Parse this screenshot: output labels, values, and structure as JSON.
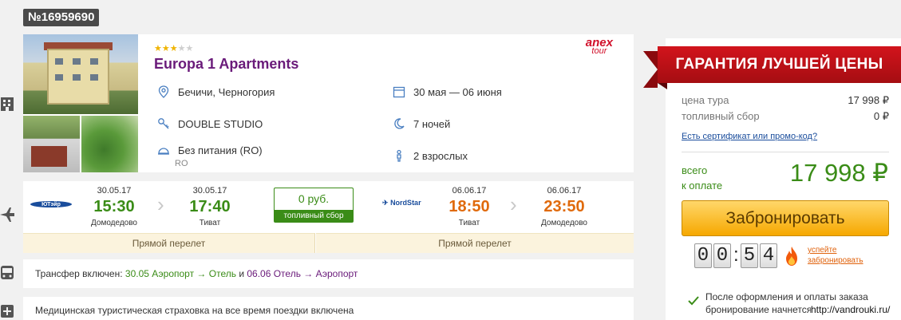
{
  "order": {
    "id": "№16959690"
  },
  "hotel": {
    "stars_filled": 3,
    "stars_total": 5,
    "name": "Europa 1 Apartments",
    "brand_line1": "anex",
    "brand_line2": "tour",
    "location": "Бечичи, Черногория",
    "dates": "30 мая — 06 июня",
    "room": "DOUBLE STUDIO",
    "nights": "7 ночей",
    "meal": "Без питания (RO)",
    "meal_code": "RO",
    "guests": "2 взрослых"
  },
  "flights": {
    "outbound": {
      "airline": "ЮТэйр",
      "dep_date": "30.05.17",
      "dep_time": "15:30",
      "dep_airport": "Домодедово",
      "arr_date": "30.05.17",
      "arr_time": "17:40",
      "arr_airport": "Тиват",
      "direct_label": "Прямой перелет"
    },
    "fuel_fee": {
      "value": "0 руб.",
      "label": "топливный сбор"
    },
    "return": {
      "airline": "NordStar",
      "dep_date": "06.06.17",
      "dep_time": "18:50",
      "dep_airport": "Тиват",
      "arr_date": "06.06.17",
      "arr_time": "23:50",
      "arr_airport": "Домодедово",
      "direct_label": "Прямой перелет"
    }
  },
  "transfer": {
    "prefix": "Трансфер включен: ",
    "leg1": "30.05 Аэропорт → Отель",
    "joiner": " и ",
    "leg2": "06.06 Отель → Аэропорт"
  },
  "insurance": {
    "text": "Медицинская туристическая страховка на все время поездки включена"
  },
  "pricing": {
    "banner": "ГАРАНТИЯ ЛУЧШЕЙ ЦЕНЫ",
    "tour_price_label": "цена тура",
    "tour_price_value": "17 998 ₽",
    "fuel_label": "топливный сбор",
    "fuel_value": "0 ₽",
    "promo_link": "Есть сертификат или промо-код?",
    "total_label_1": "всего",
    "total_label_2": "к оплате",
    "total_value": "17 998 ₽",
    "book_button": "Забронировать",
    "timer_digits": [
      "0",
      "0",
      "5",
      "4"
    ],
    "hurry_1": "успейте",
    "hurry_2": "забронировать",
    "after_note": "После оформления и оплаты заказа бронирование начнется"
  },
  "watermark": "http://vandrouki.ru/",
  "colors": {
    "green": "#3a8c17",
    "orange": "#e06a0c",
    "purple": "#6a1b7a",
    "red": "#d1102a",
    "button": "#f6a800"
  }
}
